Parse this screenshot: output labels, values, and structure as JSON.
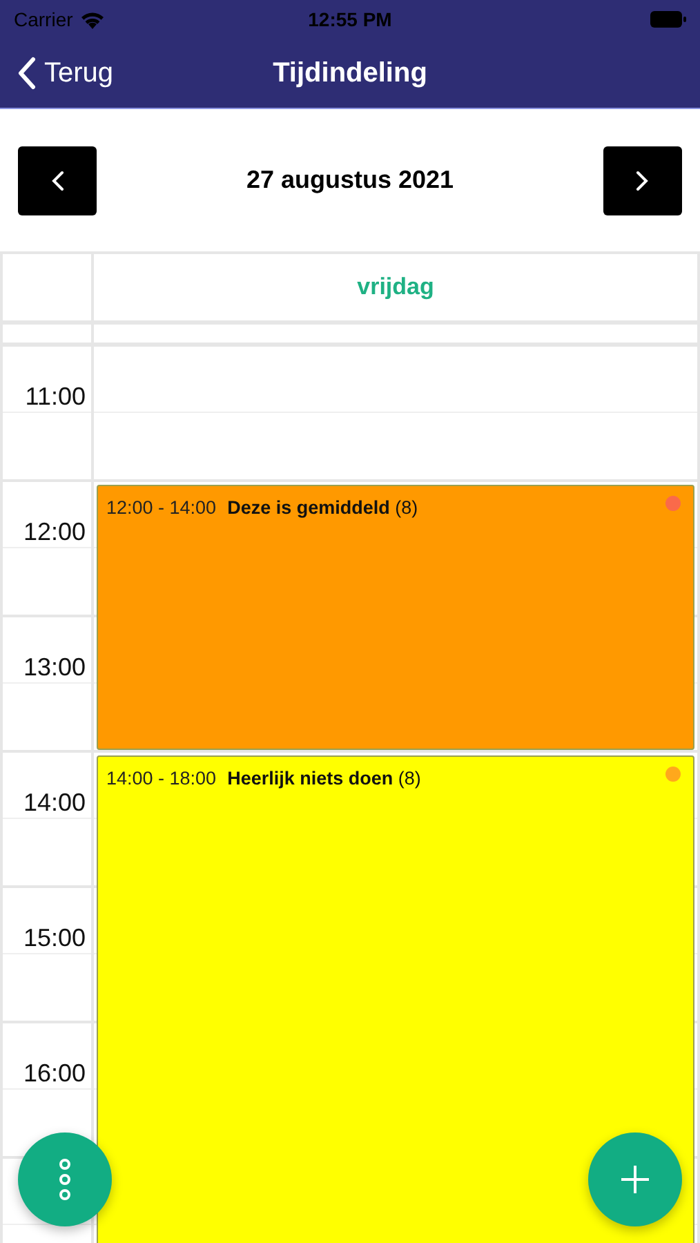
{
  "status_bar": {
    "carrier": "Carrier",
    "time": "12:55 PM"
  },
  "nav": {
    "back": "Terug",
    "title": "Tijdindeling"
  },
  "date": "27 augustus 2021",
  "day": "vrijdag",
  "hours": [
    "11:00",
    "12:00",
    "13:00",
    "14:00",
    "15:00",
    "16:00"
  ],
  "events": [
    {
      "time": "12:00 - 14:00",
      "title": "**Deze is gemiddeld** (8)",
      "color": "#ff9900",
      "dot": {
        "color": "#fa6a4a"
      }
    },
    {
      "time": "14:00 - 18:00",
      "title": "**Heerlijk niets doen** (8)",
      "color": "#ffff00",
      "dot": {
        "color": "#ffa81c"
      }
    }
  ]
}
